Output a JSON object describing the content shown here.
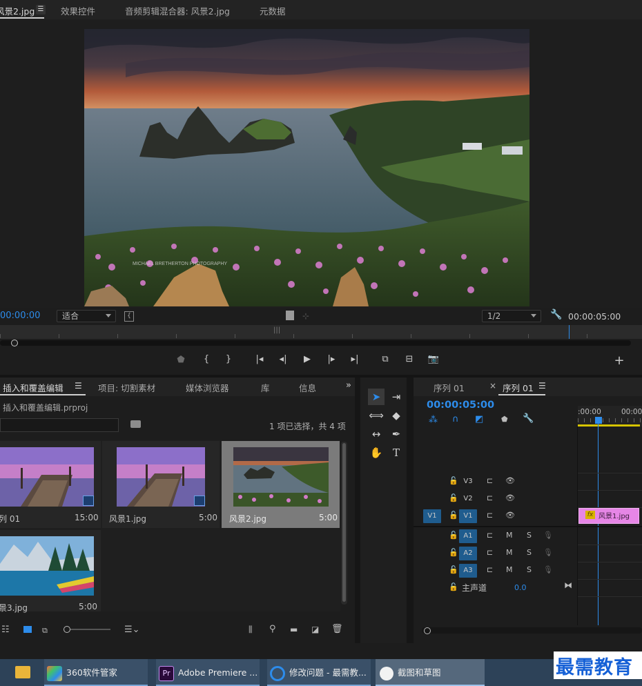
{
  "top_tabs": [
    {
      "label": "风景2.jpg",
      "active": true
    },
    {
      "label": "效果控件"
    },
    {
      "label": "音频剪辑混合器: 风景2.jpg"
    },
    {
      "label": "元数据"
    }
  ],
  "source_monitor": {
    "timecode_in": "00:00:00",
    "fit_label": "适合",
    "resolution": "1/2",
    "timecode_duration": "00:00:05:00",
    "photo_watermark": "MICHAEL BRETHERTON PHOTOGRAPHY"
  },
  "project_panel": {
    "tabs": [
      {
        "label": ": 插入和覆盖编辑",
        "active": true
      },
      {
        "label": "项目: 切割素材"
      },
      {
        "label": "媒体浏览器"
      },
      {
        "label": "库"
      },
      {
        "label": "信息"
      }
    ],
    "project_file": "插入和覆盖编辑.prproj",
    "selection_info": "1 项已选择，共 4 项",
    "items": [
      {
        "name": "列 01",
        "duration": "15:00"
      },
      {
        "name": "风景1.jpg",
        "duration": "5:00"
      },
      {
        "name": "风景2.jpg",
        "duration": "5:00",
        "selected": true
      },
      {
        "name": "景3.jpg",
        "duration": "5:00"
      }
    ]
  },
  "timeline": {
    "tabs": [
      {
        "label": "序列 01"
      },
      {
        "label": "序列 01",
        "active": true
      }
    ],
    "timecode": "00:00:05:00",
    "ruler_labels": [
      ":00:00",
      "00:00"
    ],
    "tracks": {
      "video": [
        "V3",
        "V2",
        "V1"
      ],
      "source_patch": "V1",
      "audio": [
        "A1",
        "A2",
        "A3"
      ],
      "mute_label": "M",
      "solo_label": "S",
      "master_label": "主声道",
      "master_value": "0.0"
    },
    "clip": {
      "fx_label": "fx",
      "name": "风景1.jpg"
    }
  },
  "taskbar": {
    "items": [
      {
        "label": "360软件管家"
      },
      {
        "label": "Adobe Premiere ..."
      },
      {
        "label": "修改问题 - 最需教..."
      },
      {
        "label": "截图和草图"
      }
    ],
    "brand": "最需教育"
  },
  "colors": {
    "accent": "#2d8ceb",
    "clip_pink": "#e686e6",
    "track_blue": "#1f5c8e",
    "brand_blue": "#1560d6"
  }
}
